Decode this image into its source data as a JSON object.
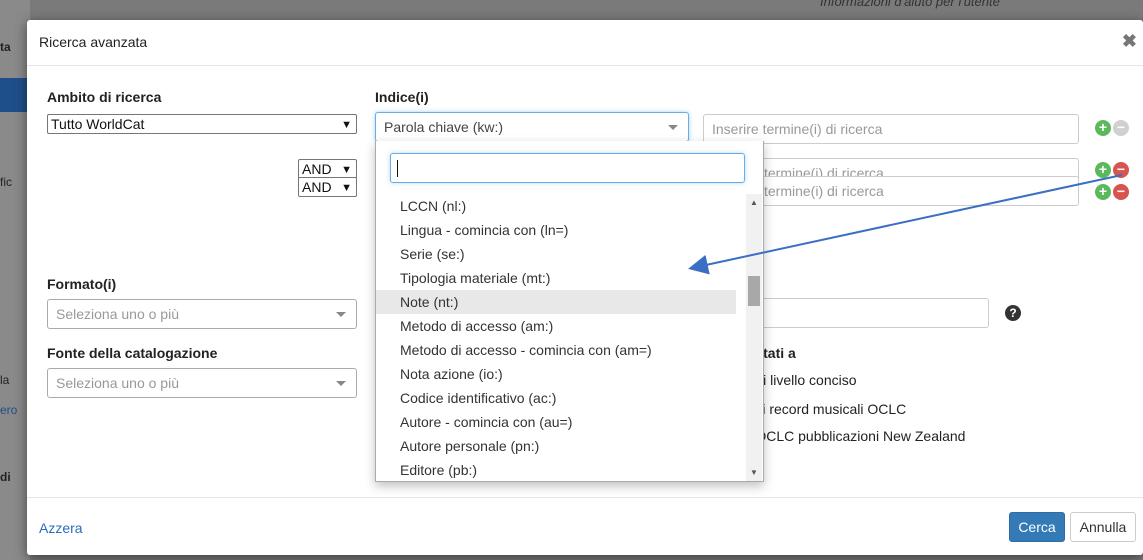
{
  "background": {
    "top_text": "Informazioni d'aiuto per l'utente",
    "left_fragments": [
      "ta",
      "fic",
      "la",
      "ero",
      "di"
    ]
  },
  "dialog": {
    "title": "Ricerca avanzata",
    "close_icon": "close-icon"
  },
  "scope": {
    "label": "Ambito di ricerca",
    "value": "Tutto WorldCat"
  },
  "index": {
    "label": "Indice(i)",
    "value": "Parola chiave (kw:)"
  },
  "rows": [
    {
      "operator": "",
      "term_placeholder": "Inserire termine(i) di ricerca"
    },
    {
      "operator": "AND",
      "term_placeholder": "termine(i) di ricerca"
    },
    {
      "operator": "AND",
      "term_placeholder": "termine(i) di ricerca"
    }
  ],
  "format": {
    "label": "Formato(i)",
    "placeholder": "Seleziona uno o più"
  },
  "cataloging_source": {
    "label": "Fonte della catalogazione",
    "placeholder": "Seleziona uno o più"
  },
  "limit_results": {
    "label_partial": "isultati a",
    "options": [
      "rd di livello conciso",
      "to di record musicali OCLC",
      "rd OCLC pubblicazioni New Zealand"
    ]
  },
  "help_icon": "question-circle-icon",
  "dropdown": {
    "search_value": "",
    "items": [
      "LCCN (nl:)",
      "Lingua - comincia con (ln=)",
      "Serie (se:)",
      "Tipologia materiale (mt:)",
      "Note (nt:)",
      "Metodo di accesso (am:)",
      "Metodo di accesso - comincia con (am=)",
      "Nota azione (io:)",
      "Codice identificativo (ac:)",
      "Autore - comincia con (au=)",
      "Autore personale (pn:)",
      "Editore (pb:)"
    ],
    "highlighted_index": 4
  },
  "footer": {
    "reset_label": "Azzera",
    "search_label": "Cerca",
    "cancel_label": "Annulla"
  },
  "colors": {
    "primary": "#337ab7",
    "plus": "#5cb85c",
    "minus": "#d9534f",
    "annotation_arrow": "#3a6fc4"
  }
}
